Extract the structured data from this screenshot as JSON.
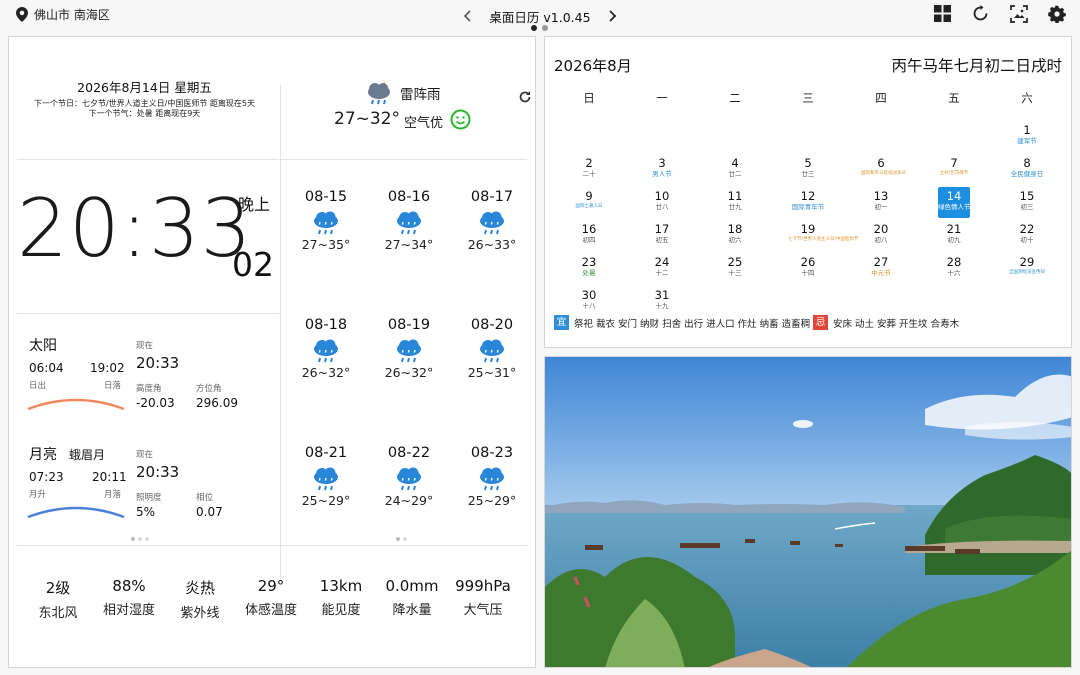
{
  "topbar": {
    "location": "佛山市 南海区",
    "title": "桌面日历 v1.0.45"
  },
  "today": {
    "date_line": "2026年8月14日   星期五",
    "next_festival": "下一个节日：七夕节/世界人道主义日/中国医师节     距离现在5天",
    "next_term": "下一个节气：处暑     距离现在9天"
  },
  "clock": {
    "time": "20:33",
    "period": "晚上",
    "seconds": "02"
  },
  "sun": {
    "title": "太阳",
    "rise": "06:04",
    "set": "19:02",
    "rise_label": "日出",
    "set_label": "日落",
    "now_label": "现在",
    "now": "20:33",
    "alt_label": "高度角",
    "alt": "-20.03",
    "az_label": "方位角",
    "az": "296.09"
  },
  "moon": {
    "title": "月亮",
    "phase_name": "蛾眉月",
    "rise": "07:23",
    "set": "20:11",
    "rise_label": "月升",
    "set_label": "月落",
    "now_label": "现在",
    "now": "20:33",
    "illum_label": "照明度",
    "illum": "5%",
    "phase_label": "相位",
    "phase": "0.07"
  },
  "weather": {
    "condition": "雷阵雨",
    "temp": "27~32°",
    "aqi": "空气优",
    "forecast": [
      {
        "date": "08-15",
        "temp": "27~35°"
      },
      {
        "date": "08-16",
        "temp": "27~34°"
      },
      {
        "date": "08-17",
        "temp": "26~33°"
      },
      {
        "date": "08-18",
        "temp": "26~32°"
      },
      {
        "date": "08-19",
        "temp": "26~32°"
      },
      {
        "date": "08-20",
        "temp": "25~31°"
      },
      {
        "date": "08-21",
        "temp": "25~29°"
      },
      {
        "date": "08-22",
        "temp": "24~29°"
      },
      {
        "date": "08-23",
        "temp": "25~29°"
      }
    ]
  },
  "stats": [
    {
      "value": "2级",
      "label": "东北风"
    },
    {
      "value": "88%",
      "label": "相对湿度"
    },
    {
      "value": "炎热",
      "label": "紫外线"
    },
    {
      "value": "29°",
      "label": "体感温度"
    },
    {
      "value": "13km",
      "label": "能见度"
    },
    {
      "value": "0.0mm",
      "label": "降水量"
    },
    {
      "value": "999hPa",
      "label": "大气压"
    }
  ],
  "calendar": {
    "month": "2026年8月",
    "lunar": "丙午马年七月初二日戌时",
    "weekdays": [
      "日",
      "一",
      "二",
      "三",
      "四",
      "五",
      "六"
    ],
    "days": [
      {
        "n": "1",
        "l": "建军节",
        "t": "hol"
      },
      {
        "n": "2",
        "l": "二十",
        "t": ""
      },
      {
        "n": "3",
        "l": "男人节",
        "t": "hol"
      },
      {
        "n": "4",
        "l": "廿二",
        "t": ""
      },
      {
        "n": "5",
        "l": "廿三",
        "t": ""
      },
      {
        "n": "6",
        "l": "国际和平与反核战争日",
        "t": "fest"
      },
      {
        "n": "7",
        "l": "立秋/乞巧情节",
        "t": "fest"
      },
      {
        "n": "8",
        "l": "全民健身日",
        "t": "hol"
      },
      {
        "n": "9",
        "l": "国际土著人日",
        "t": "hol"
      },
      {
        "n": "10",
        "l": "廿八",
        "t": ""
      },
      {
        "n": "11",
        "l": "廿九",
        "t": ""
      },
      {
        "n": "12",
        "l": "国际青年节",
        "t": "hol"
      },
      {
        "n": "13",
        "l": "初一",
        "t": ""
      },
      {
        "n": "14",
        "l": "绿色情人节",
        "t": "hol"
      },
      {
        "n": "15",
        "l": "初三",
        "t": ""
      },
      {
        "n": "16",
        "l": "初四",
        "t": ""
      },
      {
        "n": "17",
        "l": "初五",
        "t": ""
      },
      {
        "n": "18",
        "l": "初六",
        "t": ""
      },
      {
        "n": "19",
        "l": "七夕节/世界人道主义日/中国医师节",
        "t": "fest"
      },
      {
        "n": "20",
        "l": "初八",
        "t": ""
      },
      {
        "n": "21",
        "l": "初九",
        "t": ""
      },
      {
        "n": "22",
        "l": "初十",
        "t": ""
      },
      {
        "n": "23",
        "l": "处暑",
        "t": "term"
      },
      {
        "n": "24",
        "l": "十二",
        "t": ""
      },
      {
        "n": "25",
        "l": "十三",
        "t": ""
      },
      {
        "n": "26",
        "l": "十四",
        "t": ""
      },
      {
        "n": "27",
        "l": "中元节",
        "t": "fest"
      },
      {
        "n": "28",
        "l": "十六",
        "t": ""
      },
      {
        "n": "29",
        "l": "全国测绘法宣传日",
        "t": "hol"
      },
      {
        "n": "30",
        "l": "十八",
        "t": ""
      },
      {
        "n": "31",
        "l": "十九",
        "t": ""
      }
    ],
    "yi_label": "宜",
    "yi": "祭祀 裁衣 安门 纳财 扫舍 出行 进人口 作灶 纳畜 造畜稠",
    "ji_label": "忌",
    "ji": "安床 动土 安葬 开生坟 合寿木"
  },
  "colors": {
    "accent": "#1d8fe0",
    "yi": "#2e8fd6",
    "ji": "#e0463a",
    "sun_arc": "#f08a5d",
    "moon_arc": "#4a80d8",
    "aqi": "#2eb82e"
  }
}
